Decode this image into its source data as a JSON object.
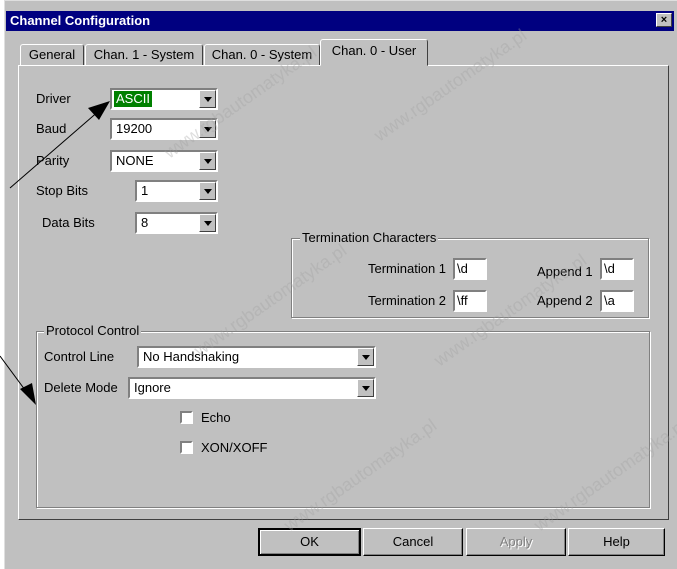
{
  "window": {
    "title": "Channel Configuration",
    "close_label": "×"
  },
  "tabs": [
    {
      "label": "General"
    },
    {
      "label": "Chan. 1 - System"
    },
    {
      "label": "Chan. 0 - System"
    },
    {
      "label": "Chan. 0 - User"
    }
  ],
  "fields": {
    "driver": {
      "label": "Driver",
      "value": "ASCII"
    },
    "baud": {
      "label": "Baud",
      "value": "19200"
    },
    "parity": {
      "label": "Parity",
      "value": "NONE"
    },
    "stop_bits": {
      "label": "Stop Bits",
      "value": "1"
    },
    "data_bits": {
      "label": "Data Bits",
      "value": "8"
    }
  },
  "termination": {
    "title": "Termination Characters",
    "term1_label": "Termination 1",
    "term1_value": "\\d",
    "term2_label": "Termination 2",
    "term2_value": "\\ff",
    "append1_label": "Append 1",
    "append1_value": "\\d",
    "append2_label": "Append 2",
    "append2_value": "\\a"
  },
  "protocol": {
    "title": "Protocol Control",
    "control_line_label": "Control Line",
    "control_line_value": "No Handshaking",
    "delete_mode_label": "Delete Mode",
    "delete_mode_value": "Ignore",
    "echo_label": "Echo",
    "echo_checked": false,
    "xon_label": "XON/XOFF",
    "xon_checked": false
  },
  "buttons": {
    "ok": "OK",
    "cancel": "Cancel",
    "apply": "Apply",
    "help": "Help"
  },
  "watermark": "www.rgbautomatyka.pl"
}
